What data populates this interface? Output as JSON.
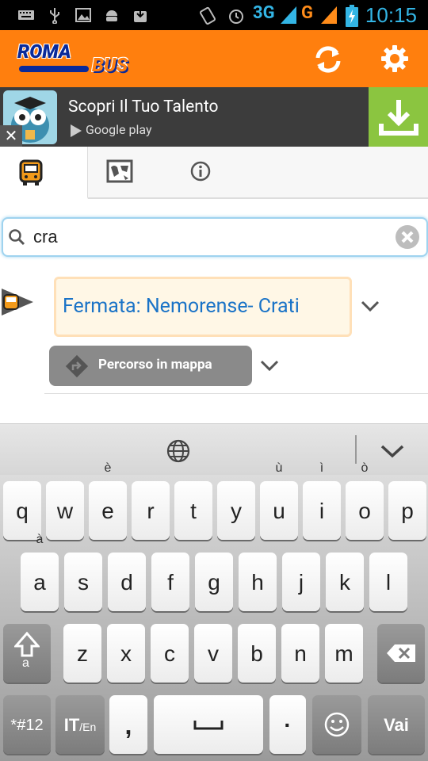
{
  "status_bar": {
    "time": "10:15",
    "network_3g": "3G",
    "network_g": "G",
    "icons": [
      "keyboard-icon",
      "usb-icon",
      "image-icon",
      "android-icon",
      "download-icon",
      "vibrate-icon",
      "alarm-icon",
      "signal-icon",
      "battery-icon"
    ]
  },
  "app_bar": {
    "logo_top": "ROMA",
    "logo_bottom": "BUS",
    "refresh_icon": "refresh-icon",
    "settings_icon": "gear-icon"
  },
  "ad": {
    "title": "Scopri Il Tuo Talento",
    "store": "Google play",
    "close": "✕"
  },
  "tabs": [
    {
      "name": "bus-icon",
      "active": true
    },
    {
      "name": "map-icon",
      "active": false
    },
    {
      "name": "info-icon",
      "active": false
    }
  ],
  "search": {
    "value": "cra",
    "placeholder": ""
  },
  "result": {
    "stop_label": "Fermata: Nemorense- Crati",
    "route_button": "Percorso in mappa"
  },
  "keyboard": {
    "row1": [
      [
        "q",
        ""
      ],
      [
        "w",
        ""
      ],
      [
        "e",
        "è"
      ],
      [
        "r",
        ""
      ],
      [
        "t",
        ""
      ],
      [
        "y",
        ""
      ],
      [
        "u",
        "ù"
      ],
      [
        "i",
        "ì"
      ],
      [
        "o",
        "ò"
      ],
      [
        "p",
        ""
      ]
    ],
    "row2": [
      [
        "a",
        "à"
      ],
      [
        "s",
        ""
      ],
      [
        "d",
        ""
      ],
      [
        "f",
        ""
      ],
      [
        "g",
        ""
      ],
      [
        "h",
        ""
      ],
      [
        "j",
        ""
      ],
      [
        "k",
        ""
      ],
      [
        "l",
        ""
      ]
    ],
    "row3": [
      "z",
      "x",
      "c",
      "v",
      "b",
      "n",
      "m"
    ],
    "symbols_label": "*#12",
    "lang_label": "IT",
    "lang_sub": "/En",
    "comma": ",",
    "period": "·",
    "go_label": "Vai"
  }
}
